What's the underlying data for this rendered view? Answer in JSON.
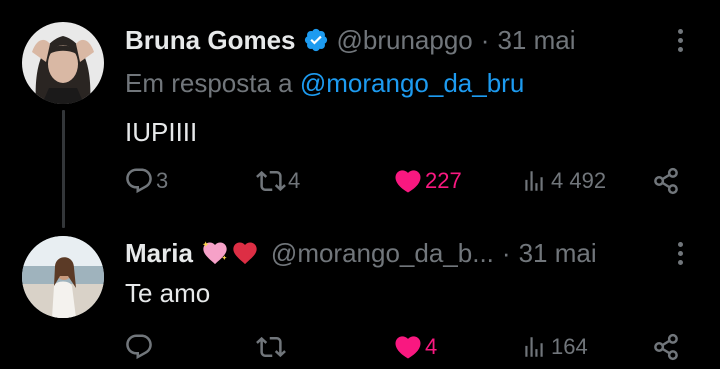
{
  "tweets": [
    {
      "author_name": "Bruna Gomes",
      "verified": true,
      "handle": "@brunapgo",
      "separator": "·",
      "date": "31 mai",
      "reply_prefix": "Em resposta a",
      "reply_mention": "@morango_da_bru",
      "text": "IUPIIII",
      "replies": "3",
      "retweets": "4",
      "likes": "227",
      "views": "4 492",
      "liked": true
    },
    {
      "author_name": "Maria",
      "name_emojis": [
        "sparkling-heart",
        "red-heart"
      ],
      "handle": "@morango_da_b...",
      "separator": "·",
      "date": "31 mai",
      "text": "Te amo",
      "replies": "",
      "retweets": "",
      "likes": "4",
      "views": "164",
      "liked": true
    }
  ],
  "colors": {
    "background": "#000000",
    "text_primary": "#e7e9ea",
    "text_secondary": "#71767b",
    "link": "#1d9bf0",
    "like": "#f91880",
    "verified": "#1d9bf0"
  }
}
